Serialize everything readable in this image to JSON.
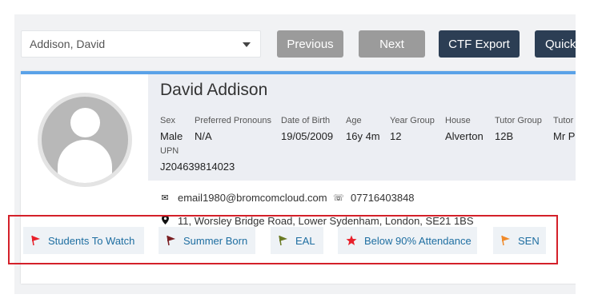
{
  "toolbar": {
    "student_select_value": "Addison, David",
    "previous_label": "Previous",
    "next_label": "Next",
    "ctf_export_label": "CTF Export",
    "quick_label": "Quick"
  },
  "student": {
    "name": "David Addison",
    "fields": {
      "sex": {
        "label": "Sex",
        "value": "Male"
      },
      "pronouns": {
        "label": "Preferred Pronouns",
        "value": "N/A"
      },
      "dob": {
        "label": "Date of Birth",
        "value": "19/05/2009"
      },
      "age": {
        "label": "Age",
        "value": "16y 4m"
      },
      "year_group": {
        "label": "Year Group",
        "value": "12"
      },
      "house": {
        "label": "House",
        "value": "Alverton"
      },
      "tutor_group": {
        "label": "Tutor Group",
        "value": "12B"
      },
      "tutor": {
        "label": "Tutor I",
        "value": "Mr P"
      },
      "upn": {
        "label": "UPN",
        "value": "J204639814023"
      }
    },
    "email": "email1980@bromcomcloud.com",
    "phone": "07716403848",
    "address": "11, Worsley Bridge Road, Lower Sydenham, London, SE21 1BS"
  },
  "flags": [
    {
      "label": "Students To Watch",
      "icon": "flag-icon",
      "color": "#e8202a"
    },
    {
      "label": "Summer Born",
      "icon": "flag-icon",
      "color": "#7a1e22"
    },
    {
      "label": "EAL",
      "icon": "flag-icon",
      "color": "#6a7a23"
    },
    {
      "label": "Below 90% Attendance",
      "icon": "star-icon",
      "color": "#e8202a"
    },
    {
      "label": "SEN",
      "icon": "flag-icon",
      "color": "#f08a2a"
    }
  ],
  "colors": {
    "accent": "#5aa2e8",
    "dark_button": "#2c3e54",
    "disabled_button": "#9b9b9b",
    "highlight_border": "#d4202a",
    "chip_text": "#1e6ea1"
  }
}
